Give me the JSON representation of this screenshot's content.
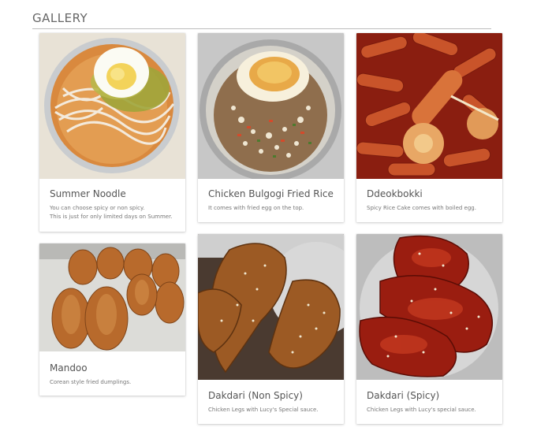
{
  "header": {
    "title": "GALLERY"
  },
  "items": [
    {
      "title": "Summer Noodle",
      "desc": "You can choose spicy or non spicy.\nThis is just for only limited days on Summer.",
      "photo": "cold-noodle-soup-image"
    },
    {
      "title": "Chicken Bulgogi Fried Rice",
      "desc": "It comes with fried egg on the top.",
      "photo": "fried-rice-with-egg-image"
    },
    {
      "title": "Ddeokbokki",
      "desc": "Spicy Rice Cake comes with boiled egg.",
      "photo": "spicy-rice-cakes-image"
    },
    {
      "title": "Mandoo",
      "desc": "Corean style fried dumplings.",
      "photo": "fried-dumplings-image"
    },
    {
      "title": "Dakdari (Non Spicy)",
      "desc": "Chicken Legs with Lucy's Special sauce.",
      "photo": "fried-chicken-legs-image"
    },
    {
      "title": "Dakdari (Spicy)",
      "desc": "Chicken Legs with Lucy's special sauce.",
      "photo": "spicy-chicken-legs-image"
    }
  ]
}
